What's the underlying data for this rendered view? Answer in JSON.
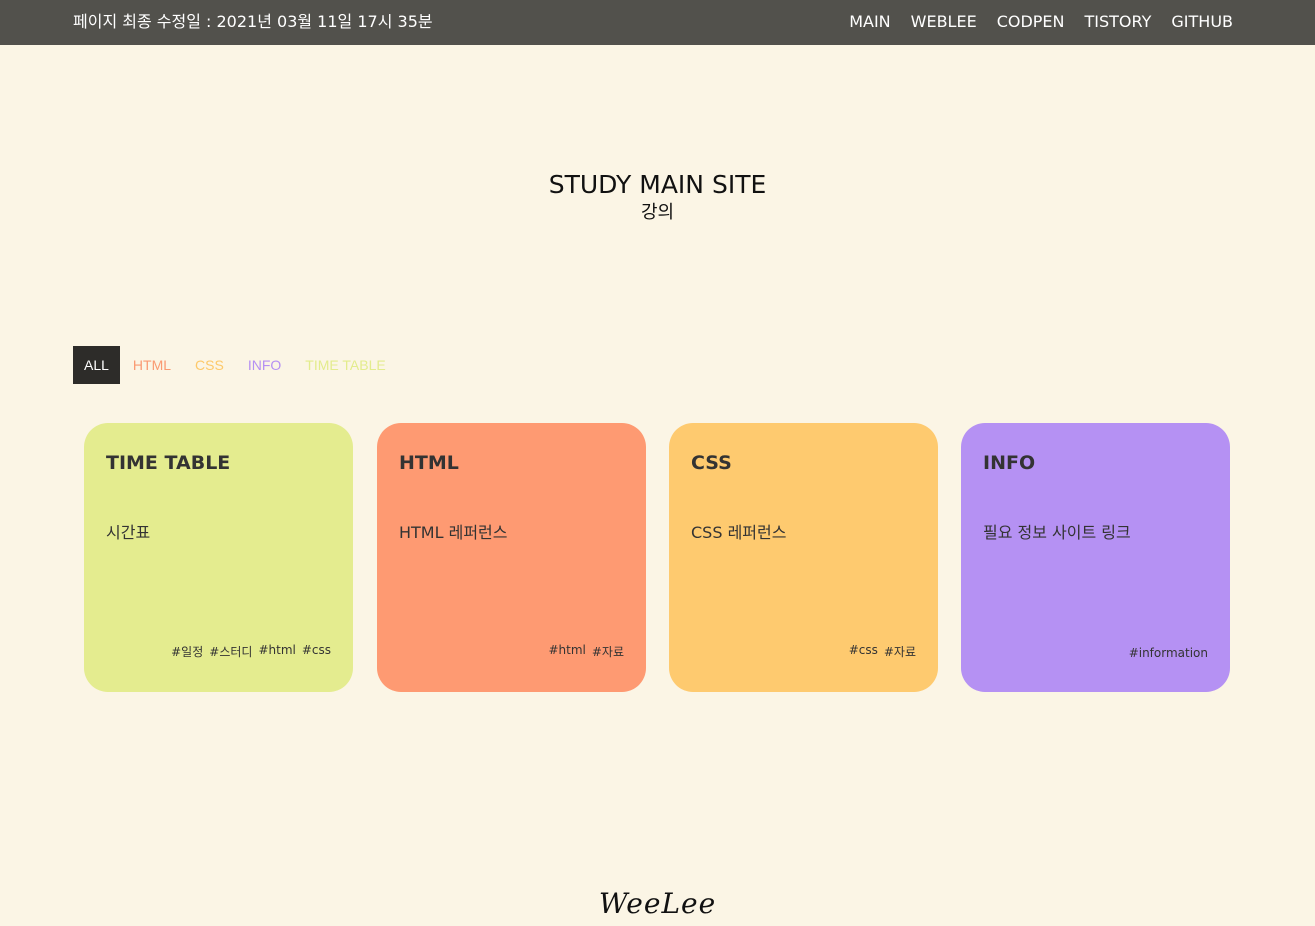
{
  "header": {
    "updated_text": "페이지 최종 수정일 : 2021년 03월 11일 17시 35분",
    "nav": [
      "MAIN",
      "WEBLEE",
      "CODPEN",
      "TISTORY",
      "GITHUB"
    ]
  },
  "hero": {
    "title": "STUDY MAIN SITE",
    "subtitle": "강의"
  },
  "filters": [
    {
      "label": "ALL",
      "color": "#ffffff",
      "active": true
    },
    {
      "label": "HTML",
      "color": "#fa9a72",
      "active": false
    },
    {
      "label": "CSS",
      "color": "#fdc96a",
      "active": false
    },
    {
      "label": "INFO",
      "color": "#b590f3",
      "active": false
    },
    {
      "label": "TIME TABLE",
      "color": "#e3ec8d",
      "active": false
    }
  ],
  "cards": [
    {
      "title": "TIME TABLE",
      "desc": "시간표",
      "tags": [
        "#일정",
        "#스터디",
        "#html",
        "#css"
      ],
      "color": "#e4ec8f"
    },
    {
      "title": "HTML",
      "desc": "HTML 레퍼런스",
      "tags": [
        "#html",
        "#자료"
      ],
      "color": "#fe9a72"
    },
    {
      "title": "CSS",
      "desc": "CSS 레퍼런스",
      "tags": [
        "#css",
        "#자료"
      ],
      "color": "#feca6f"
    },
    {
      "title": "INFO",
      "desc": "필요 정보 사이트 링크",
      "tags": [
        "#information"
      ],
      "color": "#b591f3"
    }
  ],
  "footer": {
    "logo": "WeeLee"
  },
  "colors": {
    "page_background": "#fbf5e5",
    "topbar_background": "#52514c",
    "active_filter_background": "#2d2c29"
  }
}
